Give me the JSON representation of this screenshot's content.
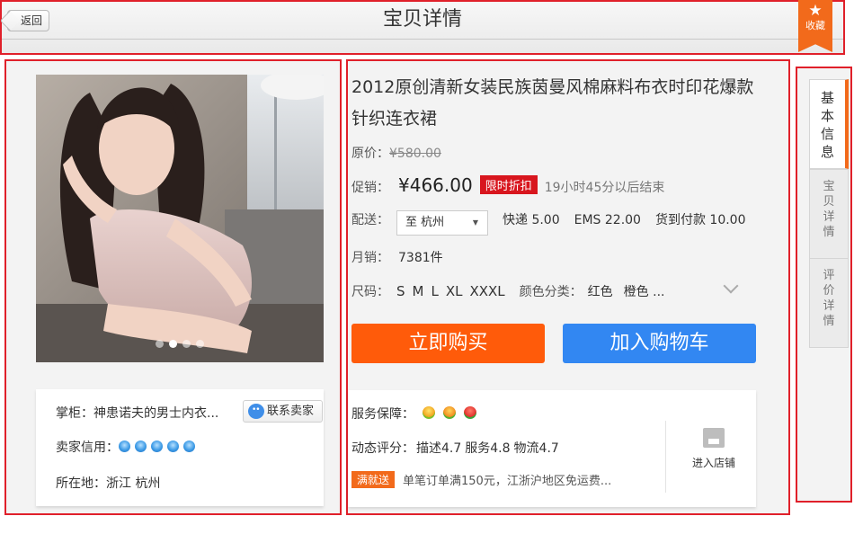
{
  "header": {
    "back_label": "返回",
    "title": "宝贝详情",
    "favorite_label": "收藏"
  },
  "gallery": {
    "total_slides": 4,
    "active_slide": 2
  },
  "seller": {
    "shopkeeper_label": "掌柜：",
    "shopkeeper_name": "神患诺夫的男士内衣...",
    "contact_label": "联系卖家",
    "credit_label": "卖家信用：",
    "credit_diamonds": 5,
    "location_label": "所在地：",
    "location_value": "浙江 杭州"
  },
  "product": {
    "title": "2012原创清新女装民族茵曼风棉麻料布衣时印花爆款针织连衣裙",
    "orig_price_label": "原价：",
    "orig_price": "¥580.00",
    "promo_label": "促销：",
    "promo_price": "¥466.00",
    "promo_tag": "限时折扣",
    "promo_timer": "19小时45分以后结束",
    "shipping_label": "配送：",
    "destination": "至 杭州",
    "fee_express": "快递 5.00",
    "fee_ems": "EMS 22.00",
    "fee_cod": "货到付款 10.00",
    "sales_label": "月销：",
    "sales_value": "7381件",
    "size_label": "尺码：",
    "sizes": [
      "S",
      "M",
      "L",
      "XL",
      "XXXL"
    ],
    "color_label": "颜色分类：",
    "colors": [
      "红色",
      "橙色 ..."
    ],
    "buy_now": "立即购买",
    "add_to_cart": "加入购物车"
  },
  "service": {
    "guarantee_label": "服务保障：",
    "rating_label": "动态评分：",
    "rating_desc": "描述4.7",
    "rating_service": "服务4.8",
    "rating_logistics": "物流4.7",
    "promo_tag": "满就送",
    "promo_text": "单笔订单满150元，江浙沪地区免运费...",
    "store_label": "进入店铺"
  },
  "side_tabs": [
    {
      "label": "基本信息",
      "active": true
    },
    {
      "label": "宝贝详情",
      "active": false
    },
    {
      "label": "评价详情",
      "active": false
    }
  ],
  "colors": {
    "annotation_red": "#e0202a",
    "accent_orange": "#f26a1b",
    "buy_orange": "#ff5b0a",
    "cart_blue": "#3287f2",
    "promo_red": "#d8161e"
  }
}
